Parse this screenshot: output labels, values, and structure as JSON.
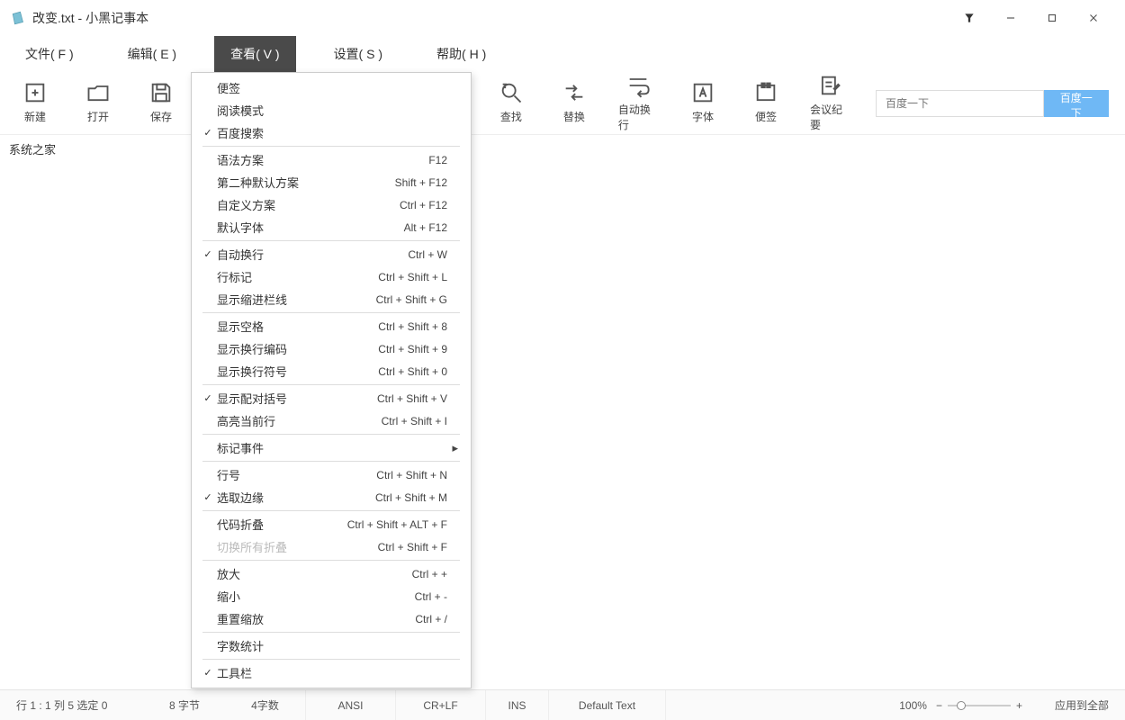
{
  "window": {
    "title": "改变.txt - 小黑记事本"
  },
  "menubar": {
    "file": "文件( F )",
    "edit": "编辑( E )",
    "view": "查看( V )",
    "settings": "设置( S )",
    "help": "帮助( H )"
  },
  "toolbar": {
    "new": "新建",
    "open": "打开",
    "save": "保存",
    "find": "查找",
    "replace": "替换",
    "wrap": "自动换行",
    "font": "字体",
    "sticky": "便签",
    "minutes": "会议纪要"
  },
  "search": {
    "placeholder": "百度一下",
    "button": "百度一下"
  },
  "editor": {
    "content": "系统之家"
  },
  "dropdown": {
    "items": [
      {
        "checked": false,
        "label": "便签",
        "shortcut": "",
        "submenu": false,
        "sep": false
      },
      {
        "checked": false,
        "label": "阅读模式",
        "shortcut": "",
        "submenu": false,
        "sep": false
      },
      {
        "checked": true,
        "label": "百度搜索",
        "shortcut": "",
        "submenu": false,
        "sep": true
      },
      {
        "checked": false,
        "label": "语法方案",
        "shortcut": "F12",
        "submenu": false,
        "sep": false
      },
      {
        "checked": false,
        "label": "第二种默认方案",
        "shortcut": "Shift + F12",
        "submenu": false,
        "sep": false
      },
      {
        "checked": false,
        "label": "自定义方案",
        "shortcut": "Ctrl + F12",
        "submenu": false,
        "sep": false
      },
      {
        "checked": false,
        "label": "默认字体",
        "shortcut": "Alt + F12",
        "submenu": false,
        "sep": true
      },
      {
        "checked": true,
        "label": "自动换行",
        "shortcut": "Ctrl + W",
        "submenu": false,
        "sep": false
      },
      {
        "checked": false,
        "label": "行标记",
        "shortcut": "Ctrl + Shift + L",
        "submenu": false,
        "sep": false
      },
      {
        "checked": false,
        "label": "显示缩进栏线",
        "shortcut": "Ctrl + Shift + G",
        "submenu": false,
        "sep": true
      },
      {
        "checked": false,
        "label": "显示空格",
        "shortcut": "Ctrl + Shift + 8",
        "submenu": false,
        "sep": false
      },
      {
        "checked": false,
        "label": "显示换行编码",
        "shortcut": "Ctrl + Shift + 9",
        "submenu": false,
        "sep": false
      },
      {
        "checked": false,
        "label": "显示换行符号",
        "shortcut": "Ctrl + Shift + 0",
        "submenu": false,
        "sep": true
      },
      {
        "checked": true,
        "label": "显示配对括号",
        "shortcut": "Ctrl + Shift + V",
        "submenu": false,
        "sep": false
      },
      {
        "checked": false,
        "label": "高亮当前行",
        "shortcut": "Ctrl + Shift + I",
        "submenu": false,
        "sep": true
      },
      {
        "checked": false,
        "label": "标记事件",
        "shortcut": "",
        "submenu": true,
        "sep": true
      },
      {
        "checked": false,
        "label": "行号",
        "shortcut": "Ctrl + Shift + N",
        "submenu": false,
        "sep": false
      },
      {
        "checked": true,
        "label": "选取边缘",
        "shortcut": "Ctrl + Shift + M",
        "submenu": false,
        "sep": true
      },
      {
        "checked": false,
        "label": "代码折叠",
        "shortcut": "Ctrl + Shift + ALT + F",
        "submenu": false,
        "sep": false
      },
      {
        "checked": false,
        "label": "切换所有折叠",
        "shortcut": "Ctrl + Shift + F",
        "submenu": false,
        "sep": true,
        "disabled": true
      },
      {
        "checked": false,
        "label": "放大",
        "shortcut": "Ctrl + +",
        "submenu": false,
        "sep": false
      },
      {
        "checked": false,
        "label": "缩小",
        "shortcut": "Ctrl + -",
        "submenu": false,
        "sep": false
      },
      {
        "checked": false,
        "label": "重置缩放",
        "shortcut": "Ctrl + /",
        "submenu": false,
        "sep": true
      },
      {
        "checked": false,
        "label": "字数统计",
        "shortcut": "",
        "submenu": false,
        "sep": true
      },
      {
        "checked": true,
        "label": "工具栏",
        "shortcut": "",
        "submenu": false,
        "sep": false
      }
    ]
  },
  "status": {
    "pos": "行 1 : 1  列 5  选定 0",
    "bytes": "8 字节",
    "chars": "4字数",
    "encoding": "ANSI",
    "lineending": "CR+LF",
    "mode": "INS",
    "syntax": "Default Text",
    "zoom": "100%",
    "apply_all": "应用到全部"
  },
  "watermark_text": "系统之家"
}
